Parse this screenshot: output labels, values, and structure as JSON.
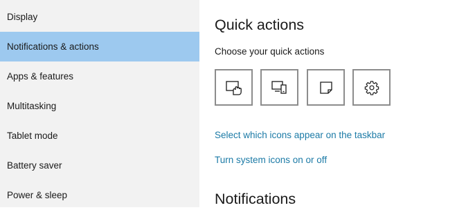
{
  "sidebar": {
    "items": [
      {
        "label": "Display"
      },
      {
        "label": "Notifications & actions"
      },
      {
        "label": "Apps & features"
      },
      {
        "label": "Multitasking"
      },
      {
        "label": "Tablet mode"
      },
      {
        "label": "Battery saver"
      },
      {
        "label": "Power & sleep"
      }
    ],
    "active_item": "Notifications & actions"
  },
  "quick_actions": {
    "title": "Quick actions",
    "subtitle": "Choose your quick actions",
    "buttons": [
      {
        "icon": "tablet-mode-icon"
      },
      {
        "icon": "connect-icon"
      },
      {
        "icon": "note-icon"
      },
      {
        "icon": "settings-gear-icon"
      }
    ]
  },
  "links": {
    "taskbar_icons": "Select which icons appear on the taskbar",
    "system_icons": "Turn system icons on or off"
  },
  "notifications": {
    "title": "Notifications"
  },
  "colors": {
    "sidebar_bg": "#f2f2f2",
    "active_bg": "#9dc9ef",
    "link": "#1b7aa6",
    "tile_border": "#8c8c8c"
  }
}
